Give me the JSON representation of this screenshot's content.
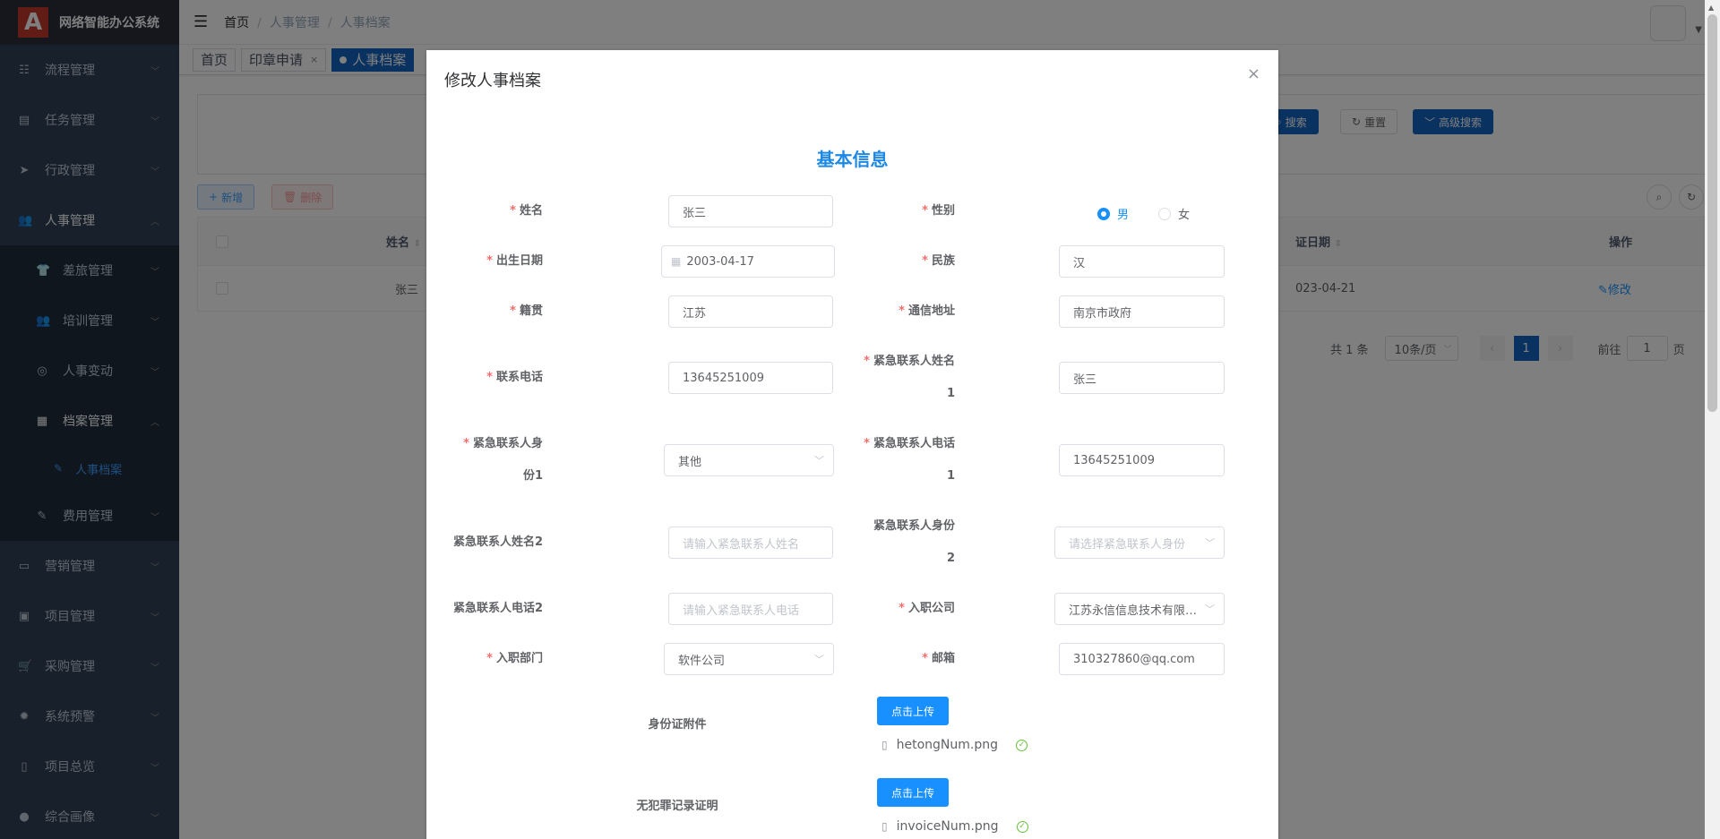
{
  "app": {
    "title": "网络智能办公系统",
    "logo_letter": "A"
  },
  "sidebar": {
    "menu_top": [
      {
        "label": "流程管理",
        "icon": "flow-icon"
      },
      {
        "label": "任务管理",
        "icon": "task-icon"
      },
      {
        "label": "行政管理",
        "icon": "send-icon"
      },
      {
        "label": "人事管理",
        "icon": "people-icon"
      }
    ],
    "sub": [
      {
        "label": "差旅管理",
        "icon": "shirt-icon"
      },
      {
        "label": "培训管理",
        "icon": "people-icon"
      },
      {
        "label": "人事变动",
        "icon": "ring-icon"
      },
      {
        "label": "档案管理",
        "icon": "archive-icon"
      }
    ],
    "leaf": {
      "label": "人事档案",
      "icon": "edit-icon"
    },
    "sub_after": {
      "label": "费用管理",
      "icon": "edit-icon"
    },
    "menu_bottom": [
      {
        "label": "营销管理",
        "icon": "board-icon"
      },
      {
        "label": "项目管理",
        "icon": "project-icon"
      },
      {
        "label": "采购管理",
        "icon": "cart-icon"
      },
      {
        "label": "系统预警",
        "icon": "bug-icon"
      },
      {
        "label": "项目总览",
        "icon": "book-icon"
      },
      {
        "label": "综合画像",
        "icon": "user-icon"
      }
    ]
  },
  "breadcrumb": [
    "首页",
    "人事管理",
    "人事档案"
  ],
  "tags": [
    {
      "label": "首页"
    },
    {
      "label": "印章申请"
    },
    {
      "label": "人事档案"
    }
  ],
  "toolbar": {
    "search": "搜索",
    "reset": "重置",
    "advanced": "高级搜索",
    "add": "新增",
    "delete": "删除"
  },
  "table": {
    "headers": {
      "name": "姓名",
      "date": "证日期",
      "action": "操作"
    },
    "rows": [
      {
        "name": "张三",
        "date": "023-04-21",
        "action": "修改"
      }
    ]
  },
  "pager": {
    "total": "共 1 条",
    "size": "10条/页",
    "page": "1",
    "goto": "前往",
    "goto_value": "1",
    "unit": "页"
  },
  "modal": {
    "title": "修改人事档案",
    "section": "基本信息",
    "fields": {
      "name": {
        "label": "姓名",
        "value": "张三"
      },
      "gender": {
        "label": "性别",
        "male": "男",
        "female": "女",
        "selected": "男"
      },
      "birthday": {
        "label": "出生日期",
        "value": "2003-04-17"
      },
      "nation": {
        "label": "民族",
        "value": "汉"
      },
      "native": {
        "label": "籍贯",
        "value": "江苏"
      },
      "address": {
        "label": "通信地址",
        "value": "南京市政府"
      },
      "phone": {
        "label": "联系电话",
        "value": "13645251009"
      },
      "ec_name1": {
        "label_a": "紧急联系人姓名",
        "label_b": "1",
        "value": "张三"
      },
      "ec_rel1": {
        "label_a": "紧急联系人身",
        "label_b": "份1",
        "value": "其他"
      },
      "ec_phone1": {
        "label_a": "紧急联系人电话",
        "label_b": "1",
        "value": "13645251009"
      },
      "ec_name2": {
        "label": "紧急联系人姓名2",
        "placeholder": "请输入紧急联系人姓名"
      },
      "ec_rel2": {
        "label_a": "紧急联系人身份",
        "label_b": "2",
        "placeholder": "请选择紧急联系人身份"
      },
      "ec_phone2": {
        "label": "紧急联系人电话2",
        "placeholder": "请输入紧急联系人电话"
      },
      "company": {
        "label": "入职公司",
        "value": "江苏永信信息技术有限公司"
      },
      "dept": {
        "label": "入职部门",
        "value": "软件公司"
      },
      "email": {
        "label": "邮箱",
        "value": "310327860@qq.com"
      },
      "id_attach": {
        "label": "身份证附件",
        "button": "点击上传",
        "file": "hetongNum.png"
      },
      "crime_attach": {
        "label": "无犯罪记录证明",
        "button": "点击上传",
        "file": "invoiceNum.png"
      }
    }
  },
  "colors": {
    "primary": "#1565c0",
    "accent": "#1890ff",
    "required": "#f56c6c",
    "sidebar": "#304156"
  }
}
